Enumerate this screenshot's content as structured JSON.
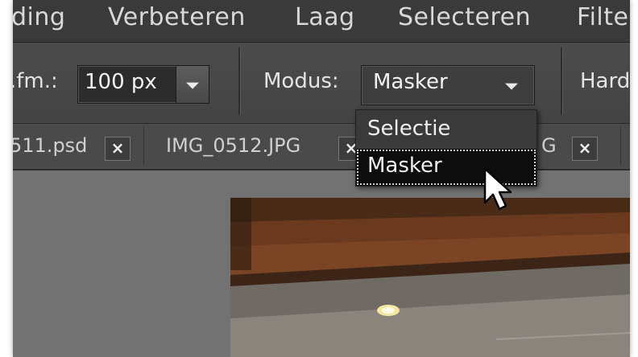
{
  "menubar": {
    "items": [
      "ding",
      "Verbeteren",
      "Laag",
      "Selecteren",
      "Filte"
    ]
  },
  "options": {
    "size_label": ".fm.:",
    "size_value": "100 px",
    "mode_label": "Modus:",
    "mode_value": "Masker",
    "hardness_label": "Hard"
  },
  "tabs": [
    {
      "label": "511.psd",
      "close": "×"
    },
    {
      "label": "IMG_0512.JPG",
      "close": "×"
    },
    {
      "label": "G",
      "close": "×"
    }
  ],
  "dropdown": {
    "options": [
      "Selectie",
      "Masker"
    ],
    "selected": "Masker"
  },
  "colors": {
    "menubar_bg": "#3a3a3a",
    "options_bg": "#474747",
    "canvas_bg": "#727272",
    "selection_bg": "#0d0d0d"
  },
  "icons": [
    "dropdown-caret-icon",
    "tab-close-icon",
    "mouse-pointer-icon"
  ]
}
